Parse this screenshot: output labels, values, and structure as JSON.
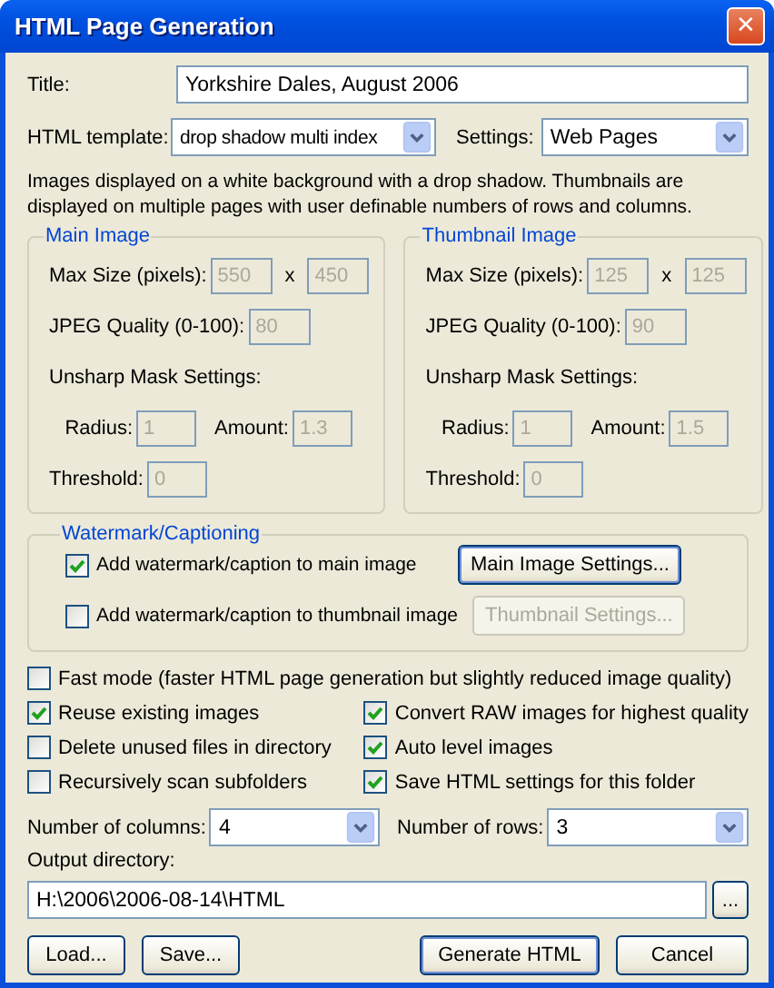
{
  "window": {
    "title": "HTML Page Generation",
    "close": "✕"
  },
  "title_field": {
    "label": "Title:",
    "value": "Yorkshire Dales, August 2006"
  },
  "template": {
    "label": "HTML template:",
    "value": "drop shadow multi index"
  },
  "settings": {
    "label": "Settings:",
    "value": "Web Pages"
  },
  "description": "Images displayed on a white background with a drop shadow. Thumbnails are displayed on multiple pages with user definable numbers of rows and columns.",
  "image_groups": [
    {
      "legend": "Main Image",
      "max_size_label": "Max Size (pixels):",
      "width": {
        "value": "550",
        "disabled": true
      },
      "times": "x",
      "height": {
        "value": "450",
        "disabled": true
      },
      "jpeg_label": "JPEG Quality (0-100):",
      "jpeg": {
        "value": "80",
        "disabled": true
      },
      "unsharp_label": "Unsharp Mask Settings:",
      "radius_label": "Radius:",
      "radius": {
        "value": "1",
        "disabled": true
      },
      "amount_label": "Amount:",
      "amount": {
        "value": "1.3",
        "disabled": true
      },
      "threshold_label": "Threshold:",
      "threshold": {
        "value": "0",
        "disabled": true
      }
    },
    {
      "legend": "Thumbnail Image",
      "max_size_label": "Max Size (pixels):",
      "width": {
        "value": "125",
        "disabled": true
      },
      "times": "x",
      "height": {
        "value": "125",
        "disabled": true
      },
      "jpeg_label": "JPEG Quality (0-100):",
      "jpeg": {
        "value": "90",
        "disabled": true
      },
      "unsharp_label": "Unsharp Mask Settings:",
      "radius_label": "Radius:",
      "radius": {
        "value": "1",
        "disabled": true
      },
      "amount_label": "Amount:",
      "amount": {
        "value": "1.5",
        "disabled": true
      },
      "threshold_label": "Threshold:",
      "threshold": {
        "value": "0",
        "disabled": true
      }
    }
  ],
  "watermark": {
    "legend": "Watermark/Captioning",
    "options": [
      {
        "label": "Add watermark/caption to main image",
        "checked": true,
        "button": {
          "label": "Main Image Settings...",
          "disabled": false
        }
      },
      {
        "label": "Add watermark/caption to thumbnail image",
        "checked": false,
        "button": {
          "label": "Thumbnail Settings...",
          "disabled": true
        }
      }
    ]
  },
  "fast_mode": {
    "label": "Fast mode (faster HTML page generation but slightly reduced image quality)",
    "checked": false
  },
  "left_options": [
    {
      "label": "Reuse existing images",
      "checked": true
    },
    {
      "label": "Delete unused files in directory",
      "checked": false
    },
    {
      "label": "Recursively scan subfolders",
      "checked": false
    }
  ],
  "right_options": [
    {
      "label": "Convert RAW images for highest quality",
      "checked": true
    },
    {
      "label": "Auto level images",
      "checked": true
    },
    {
      "label": "Save HTML settings for this folder",
      "checked": true
    }
  ],
  "columns": {
    "label": "Number of columns:",
    "value": "4"
  },
  "rows": {
    "label": "Number of rows:",
    "value": "3"
  },
  "output": {
    "label": "Output directory:",
    "value": "H:\\2006\\2006-08-14\\HTML",
    "browse": "..."
  },
  "left_buttons": [
    {
      "label": "Load...",
      "default": false
    },
    {
      "label": "Save...",
      "default": false
    }
  ],
  "right_buttons": [
    {
      "label": "Generate HTML",
      "default": true
    },
    {
      "label": "Cancel",
      "default": false
    }
  ]
}
